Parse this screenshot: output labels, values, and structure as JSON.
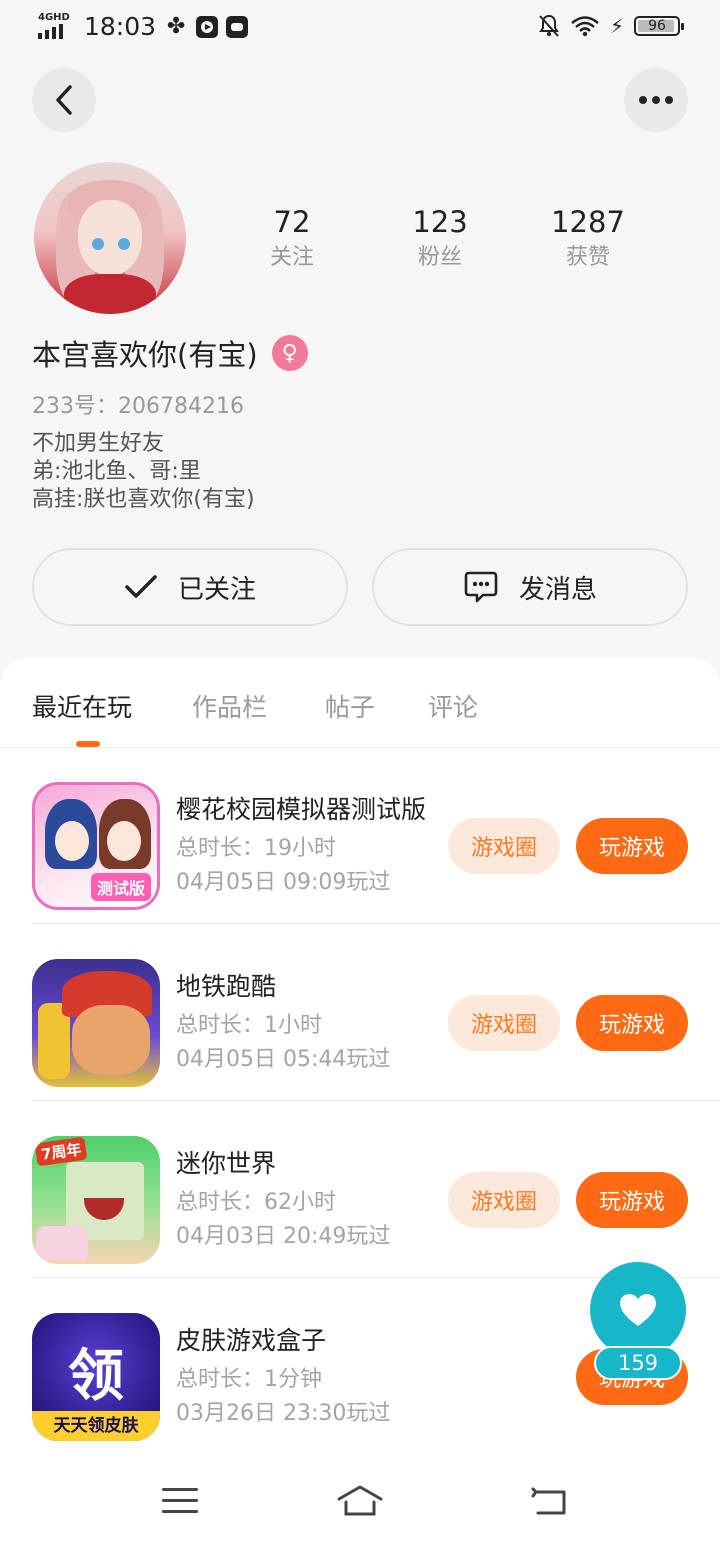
{
  "status_bar": {
    "network": "4GHD",
    "time": "18:03",
    "battery": "96"
  },
  "profile": {
    "name": "本宫喜欢你(有宝)",
    "gender_icon": "female-icon",
    "uid": "233号：206784216",
    "bio": [
      "不加男生好友",
      "弟:池北鱼、哥:里",
      "高挂:朕也喜欢你(有宝)"
    ],
    "stats": [
      {
        "value": "72",
        "label": "关注"
      },
      {
        "value": "123",
        "label": "粉丝"
      },
      {
        "value": "1287",
        "label": "获赞"
      }
    ]
  },
  "actions": {
    "follow_label": "已关注",
    "message_label": "发消息"
  },
  "tabs": [
    "最近在玩",
    "作品栏",
    "帖子",
    "评论"
  ],
  "active_tab": "最近在玩",
  "games": [
    {
      "title": "樱花校园模拟器测试版",
      "duration": "总时长：19小时",
      "last_played": "04月05日 09:09玩过",
      "circle_label": "游戏圈",
      "play_label": "玩游戏",
      "icon_tag": "测试版"
    },
    {
      "title": "地铁跑酷",
      "duration": "总时长：1小时",
      "last_played": "04月05日 05:44玩过",
      "circle_label": "游戏圈",
      "play_label": "玩游戏"
    },
    {
      "title": "迷你世界",
      "duration": "总时长：62小时",
      "last_played": "04月03日 20:49玩过",
      "circle_label": "游戏圈",
      "play_label": "玩游戏",
      "icon_tag": "7周年"
    },
    {
      "title": "皮肤游戏盒子",
      "duration": "总时长：1分钟",
      "last_played": "03月26日 23:30玩过",
      "play_label": "玩游戏",
      "icon_tag": "天天领皮肤",
      "icon_logo": "领"
    }
  ],
  "like_fab": {
    "count": "159"
  },
  "colors": {
    "accent": "#ff6a13",
    "accent_light": "#fde9dc",
    "fab": "#17b6c9",
    "female": "#f27a99"
  }
}
